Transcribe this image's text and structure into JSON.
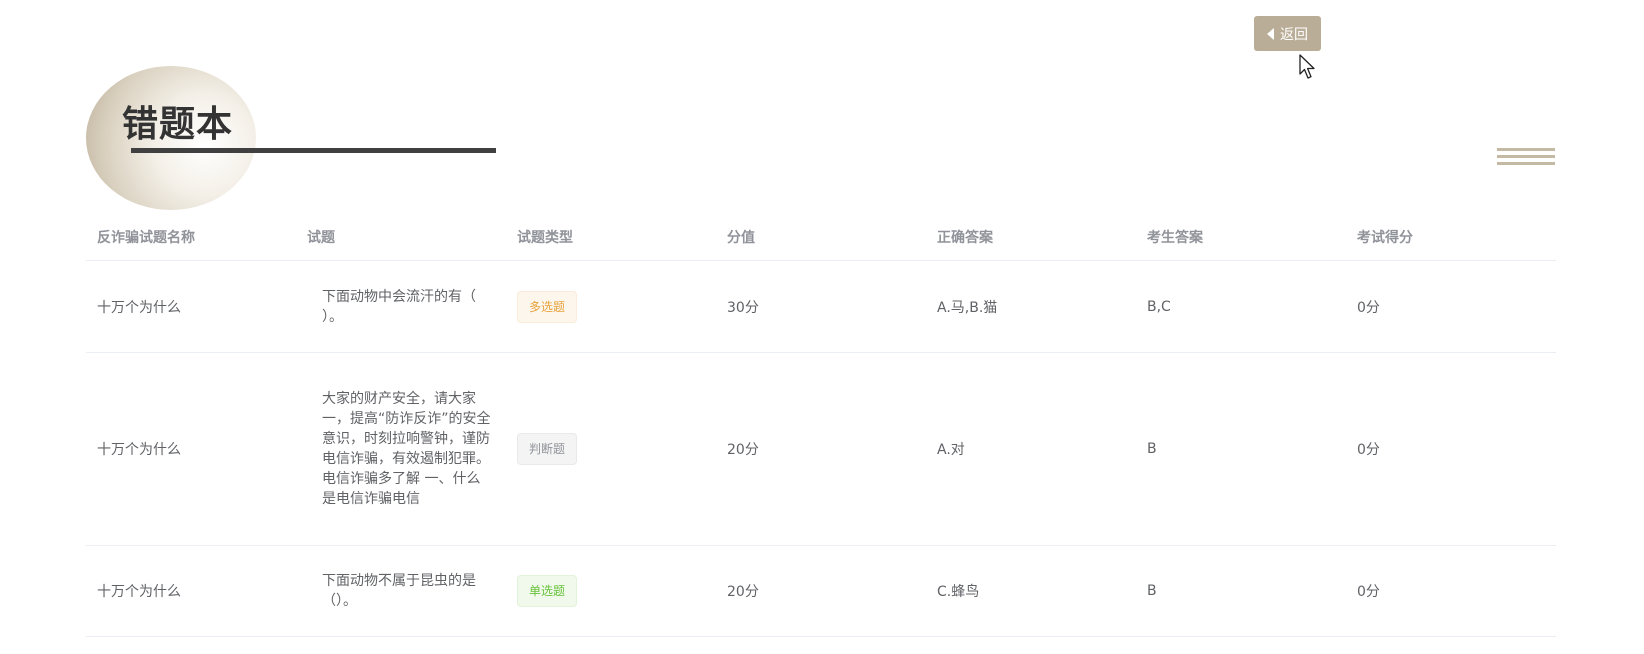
{
  "header": {
    "back_label": "返回",
    "title": "错题本"
  },
  "table": {
    "columns": [
      "反诈骗试题名称",
      "试题",
      "试题类型",
      "分值",
      "正确答案",
      "考生答案",
      "考试得分"
    ],
    "rows": [
      {
        "name": "十万个为什么",
        "question": "下面动物中会流汗的有（ ）。",
        "type": "多选题",
        "score": "30分",
        "correct": "A.马,B.猫",
        "answer": "B,C",
        "got": "0分"
      },
      {
        "name": "十万个为什么",
        "question": "大家的财产安全，请大家一，提高“防诈反诈”的安全意识，时刻拉响警钟，谨防电信诈骗，有效遏制犯罪。电信诈骗多了解 一、什么是电信诈骗电信",
        "type": "判断题",
        "score": "20分",
        "correct": "A.对",
        "answer": "B",
        "got": "0分"
      },
      {
        "name": "十万个为什么",
        "question": "下面动物不属于昆虫的是（）。",
        "type": "单选题",
        "score": "20分",
        "correct": "C.蜂鸟",
        "answer": "B",
        "got": "0分"
      }
    ]
  },
  "colors": {
    "accent": "#b9ad97",
    "tag_multi": "#e6a23c",
    "tag_judge": "#909399",
    "tag_single": "#67c23a"
  },
  "icons": {
    "back": "caret-left-icon",
    "menu": "menu-lines-icon",
    "cursor": "mouse-pointer-icon"
  }
}
